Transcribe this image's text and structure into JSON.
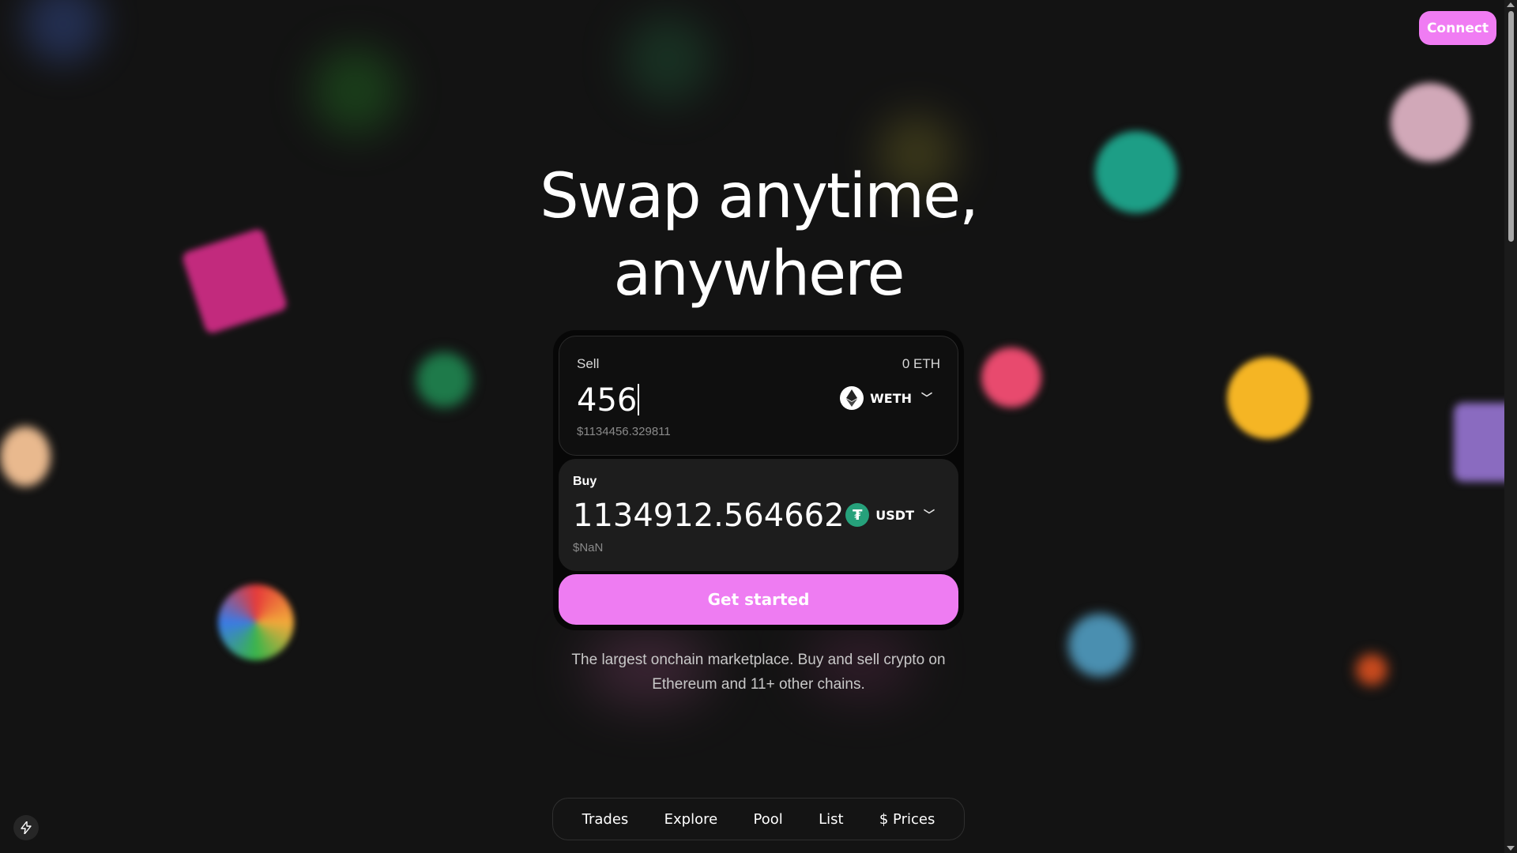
{
  "header": {
    "connect_label": "Connect"
  },
  "hero": {
    "line1": "Swap anytime,",
    "line2": "anywhere"
  },
  "swap": {
    "sell": {
      "label": "Sell",
      "balance": "0 ETH",
      "amount": "456",
      "usd_value": "$1134456.329811",
      "token": {
        "symbol": "WETH",
        "icon": "ethereum-icon"
      }
    },
    "buy": {
      "label": "Buy",
      "amount": "1134912.564662",
      "usd_value": "$NaN",
      "token": {
        "symbol": "USDT",
        "icon": "tether-icon",
        "icon_glyph": "₮"
      }
    },
    "cta_label": "Get started"
  },
  "subtitle": {
    "line1": "The largest onchain marketplace. Buy and sell crypto on",
    "line2": "Ethereum and 11+ other chains."
  },
  "nav": {
    "items": [
      {
        "label": "Trades"
      },
      {
        "label": "Explore"
      },
      {
        "label": "Pool"
      },
      {
        "label": "List"
      },
      {
        "label": "Prices",
        "icon_glyph": "$"
      }
    ]
  },
  "colors": {
    "accent": "#f07cf3",
    "background": "#131313",
    "tether_green": "#26a17b"
  }
}
